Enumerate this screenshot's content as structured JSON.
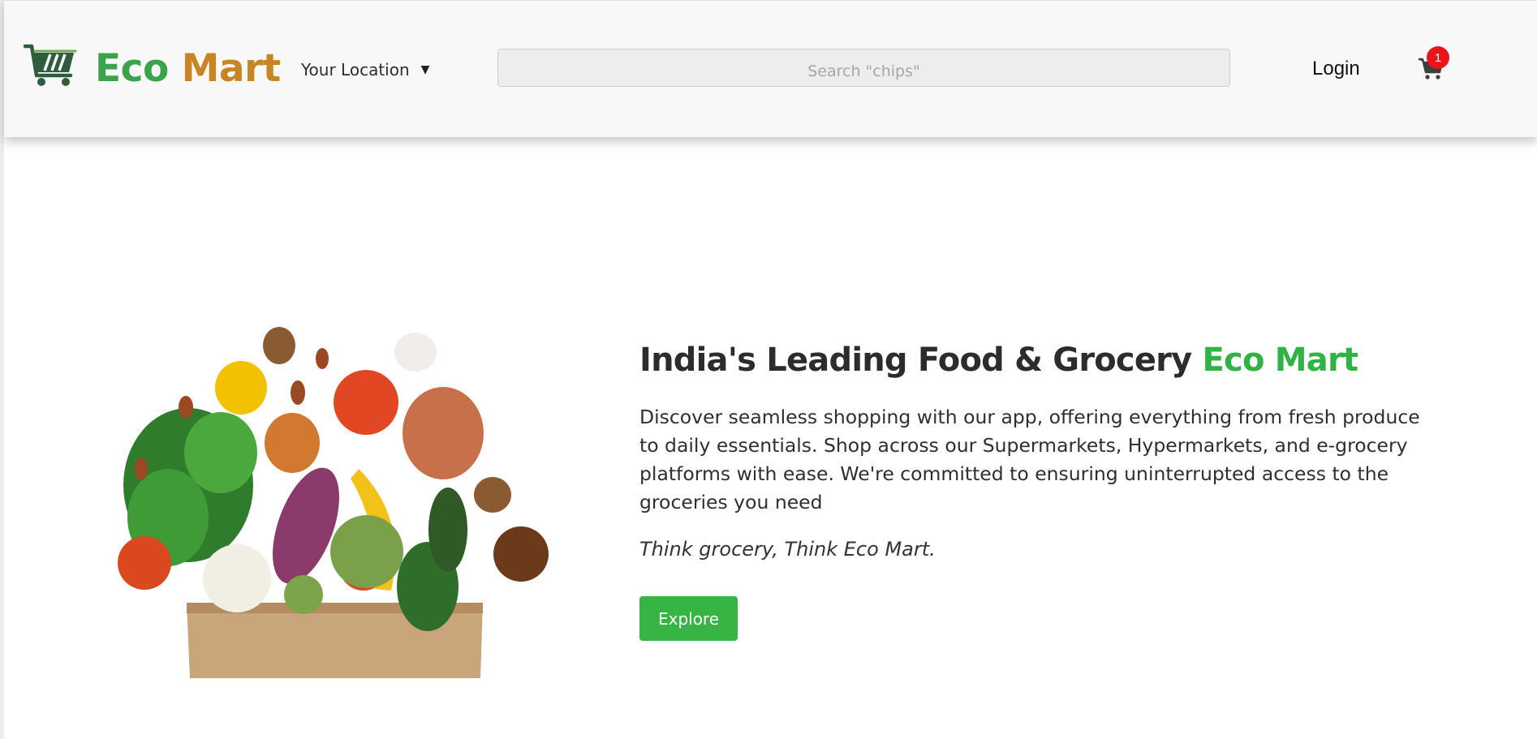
{
  "brand": {
    "name_part1": "Eco",
    "name_part2": "Mart",
    "logo_icon": "shopping-cart-logo-icon",
    "primary_color": "#3aa44a",
    "secondary_color": "#c78524"
  },
  "header": {
    "location_label": "Your Location",
    "location_caret": "▼",
    "search_placeholder": "Search \"chips\"",
    "login_label": "Login",
    "cart_icon": "cart-icon",
    "cart_count": "1"
  },
  "hero": {
    "image_icon": "grocery-bag-vegetables-image",
    "headline_main": "India's Leading Food & Grocery ",
    "headline_accent": "Eco Mart",
    "accent_color": "#2fb344",
    "description": "Discover seamless shopping with our app, offering everything from fresh produce to daily essentials. Shop across our Supermarkets, Hypermarkets, and e-grocery platforms with ease. We're committed to ensuring uninterrupted access to the groceries you need",
    "tagline": "Think grocery, Think Eco Mart.",
    "cta_label": "Explore",
    "cta_color": "#36b544"
  }
}
